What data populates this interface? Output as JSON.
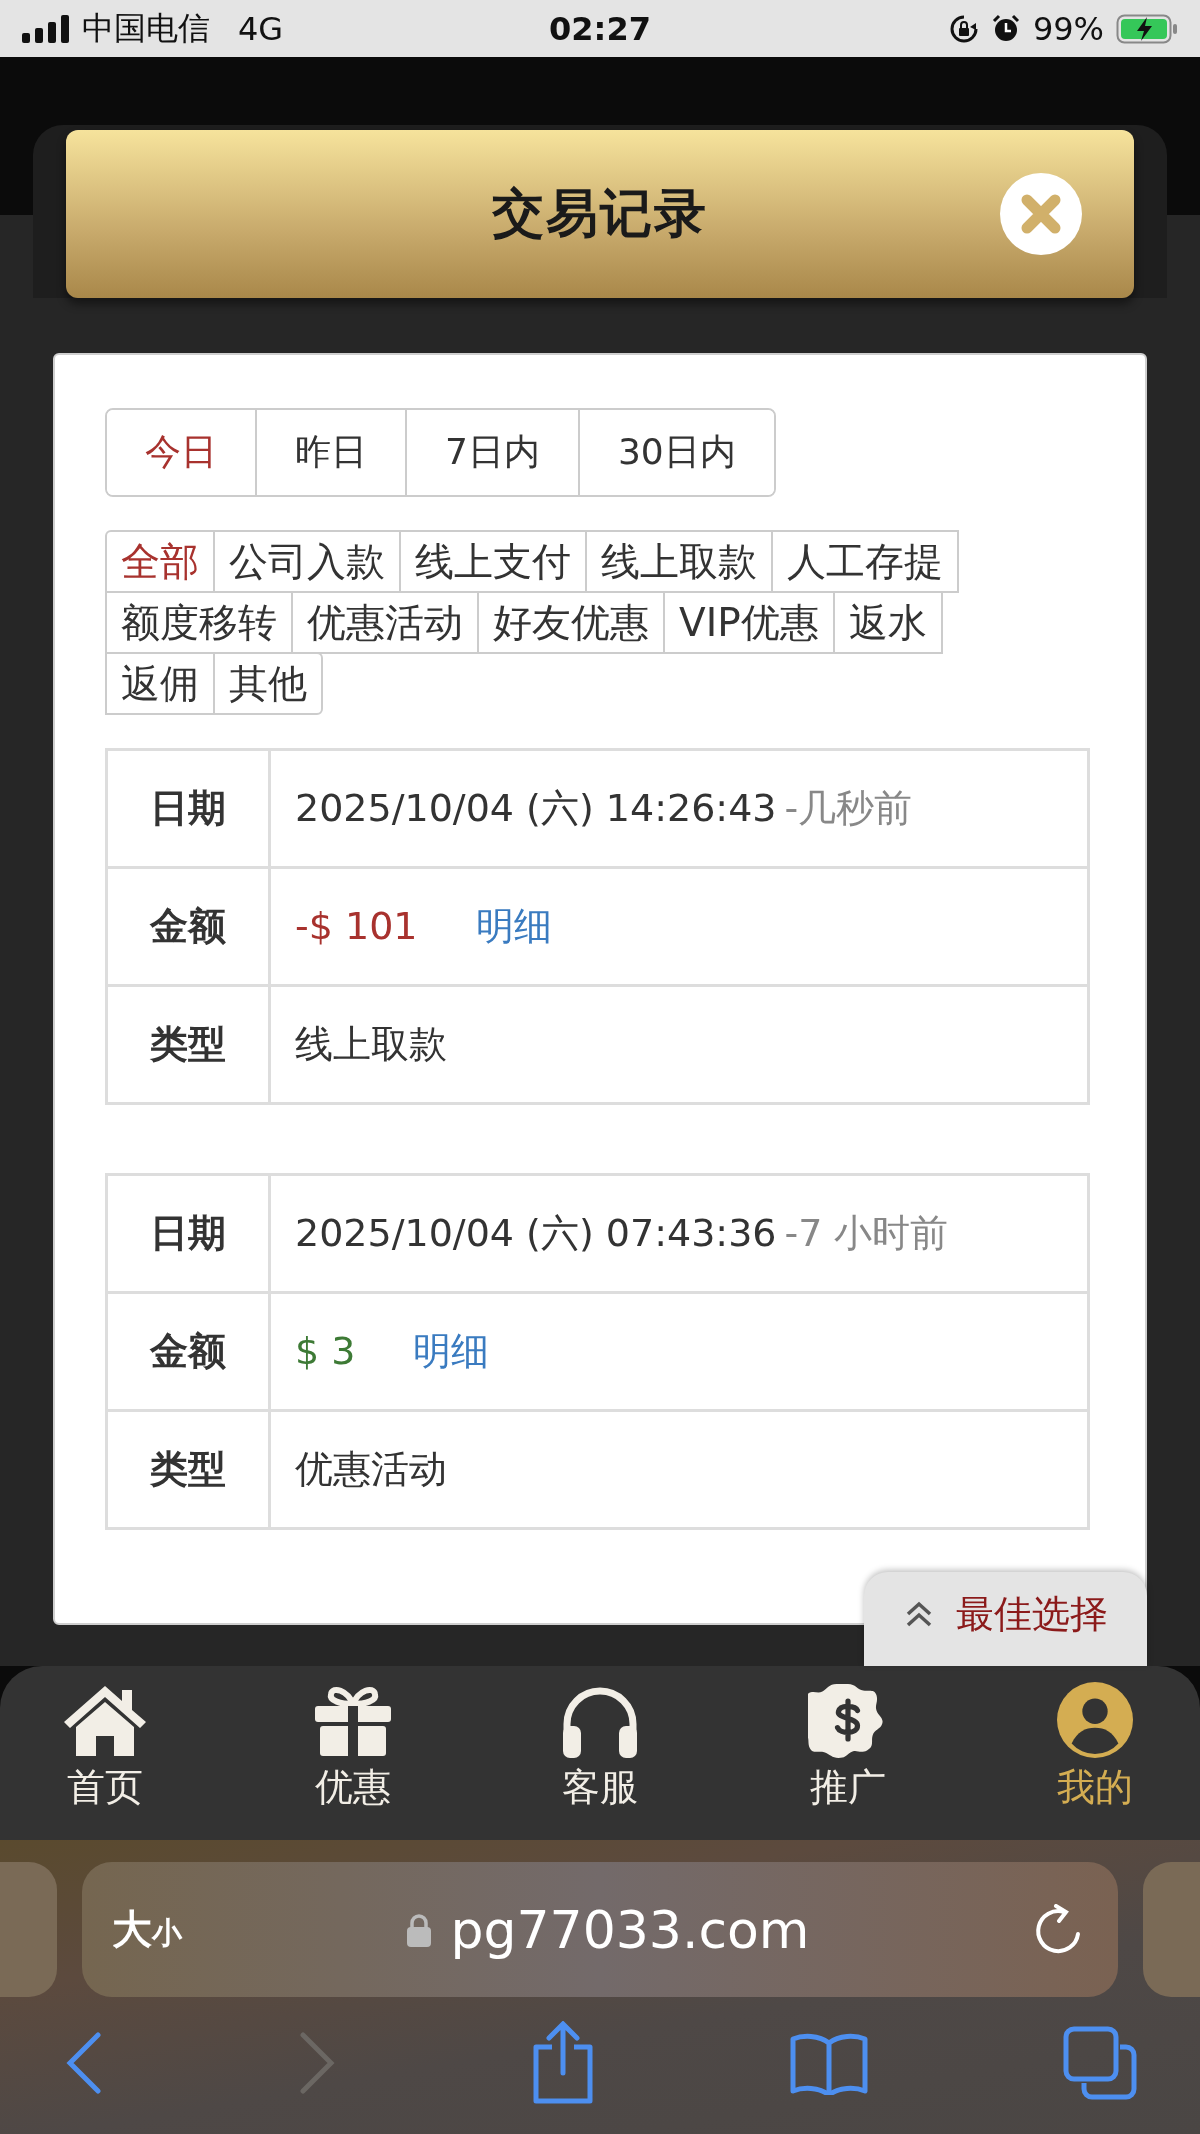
{
  "status_bar": {
    "carrier": "中国电信",
    "network": "4G",
    "time": "02:27",
    "battery": "99%"
  },
  "dialog": {
    "title": "交易记录"
  },
  "date_tabs": [
    {
      "label": "今日",
      "selected": true
    },
    {
      "label": "昨日",
      "selected": false
    },
    {
      "label": "7日内",
      "selected": false
    },
    {
      "label": "30日内",
      "selected": false
    }
  ],
  "category_rows": [
    {
      "items": [
        {
          "label": "全部",
          "selected": true
        },
        {
          "label": "公司入款",
          "selected": false
        },
        {
          "label": "线上支付",
          "selected": false
        },
        {
          "label": "线上取款",
          "selected": false
        },
        {
          "label": "人工存提",
          "selected": false
        }
      ]
    },
    {
      "items": [
        {
          "label": "额度移转",
          "selected": false
        },
        {
          "label": "优惠活动",
          "selected": false
        },
        {
          "label": "好友优惠",
          "selected": false
        },
        {
          "label": "VIP优惠",
          "selected": false
        },
        {
          "label": "返水",
          "selected": false
        }
      ]
    },
    {
      "items": [
        {
          "label": "返佣",
          "selected": false
        },
        {
          "label": "其他",
          "selected": false
        }
      ]
    }
  ],
  "records": [
    {
      "date_label": "日期",
      "date": "2025/10/04 (六) 14:26:43",
      "ago": "-几秒前",
      "amount_label": "金额",
      "amount": "-$ 101",
      "kind": "debit",
      "detail": "明细",
      "type_label": "类型",
      "type": "线上取款"
    },
    {
      "date_label": "日期",
      "date": "2025/10/04 (六) 07:43:36",
      "ago": "-7 小时前",
      "amount_label": "金额",
      "amount": "$ 3",
      "kind": "credit",
      "detail": "明细",
      "type_label": "类型",
      "type": "优惠活动"
    }
  ],
  "float_button": {
    "label": "最佳选择"
  },
  "bottom_nav": [
    {
      "label": "首页",
      "selected": false
    },
    {
      "label": "优惠",
      "selected": false
    },
    {
      "label": "客服",
      "selected": false
    },
    {
      "label": "推广",
      "selected": false
    },
    {
      "label": "我的",
      "selected": true
    }
  ],
  "browser": {
    "text_size_large": "大",
    "text_size_small": "小",
    "url": "pg77033.com"
  }
}
